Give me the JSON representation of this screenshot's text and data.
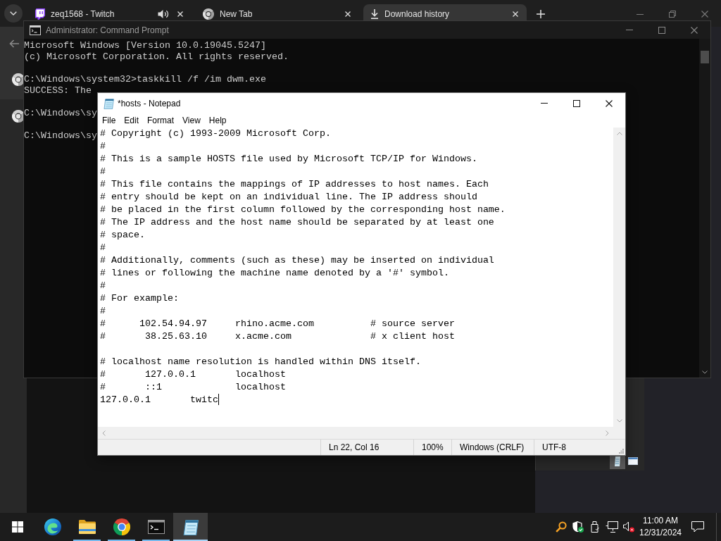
{
  "browser": {
    "tabs": [
      {
        "label": "zeq1568 - Twitch",
        "kind": "chat",
        "audio": true,
        "selected": false
      },
      {
        "label": "New Tab",
        "kind": "ring",
        "audio": false,
        "selected": false
      },
      {
        "label": "Download history",
        "kind": "download",
        "audio": false,
        "selected": true
      }
    ]
  },
  "command_prompt": {
    "title": "Administrator: Command Prompt",
    "blocks": [
      [
        "Microsoft Windows [Version 10.0.19045.5247]",
        "(c) Microsoft Corporation. All rights reserved."
      ],
      [
        "C:\\Windows\\system32>taskkill /f /im dwm.exe",
        "SUCCESS: The"
      ],
      [
        "C:\\Windows\\sy"
      ],
      [
        "C:\\Windows\\sy"
      ]
    ]
  },
  "notepad": {
    "title": "*hosts - Notepad",
    "menu": [
      "File",
      "Edit",
      "Format",
      "View",
      "Help"
    ],
    "blocks": [
      [
        "# Copyright (c) 1993-2009 Microsoft Corp.",
        "#",
        "# This is a sample HOSTS file used by Microsoft TCP/IP for Windows.",
        "#",
        "# This file contains the mappings of IP addresses to host names. Each",
        "# entry should be kept on an individual line. The IP address should",
        "# be placed in the first column followed by the corresponding host name.",
        "# The IP address and the host name should be separated by at least one",
        "# space.",
        "#",
        "# Additionally, comments (such as these) may be inserted on individual",
        "# lines or following the machine name denoted by a '#' symbol.",
        "#",
        "# For example:",
        "#",
        "#      102.54.94.97     rhino.acme.com          # source server",
        "#       38.25.63.10     x.acme.com              # x client host"
      ],
      [
        "# localhost name resolution is handled within DNS itself.",
        "#       127.0.0.1       localhost",
        "#       ::1             localhost",
        "127.0.0.1       twitc"
      ]
    ],
    "cursor_at_end": true,
    "status_bar": {
      "position": "Ln 22, Col 16",
      "zoom": "100%",
      "line_ending": "Windows (CRLF)",
      "encoding": "UTF-8"
    }
  },
  "taskbar": {
    "apps": [
      {
        "kind": "swirl",
        "running": false,
        "selected": false
      },
      {
        "kind": "folder",
        "running": true,
        "selected": false
      },
      {
        "kind": "ring",
        "running": true,
        "selected": false
      },
      {
        "kind": "terminal",
        "running": true,
        "selected": false
      },
      {
        "kind": "notepad",
        "running": true,
        "selected": true
      }
    ],
    "tray": {
      "volume_muted": true,
      "time": "11:00 AM",
      "date": "12/31/2024"
    }
  }
}
